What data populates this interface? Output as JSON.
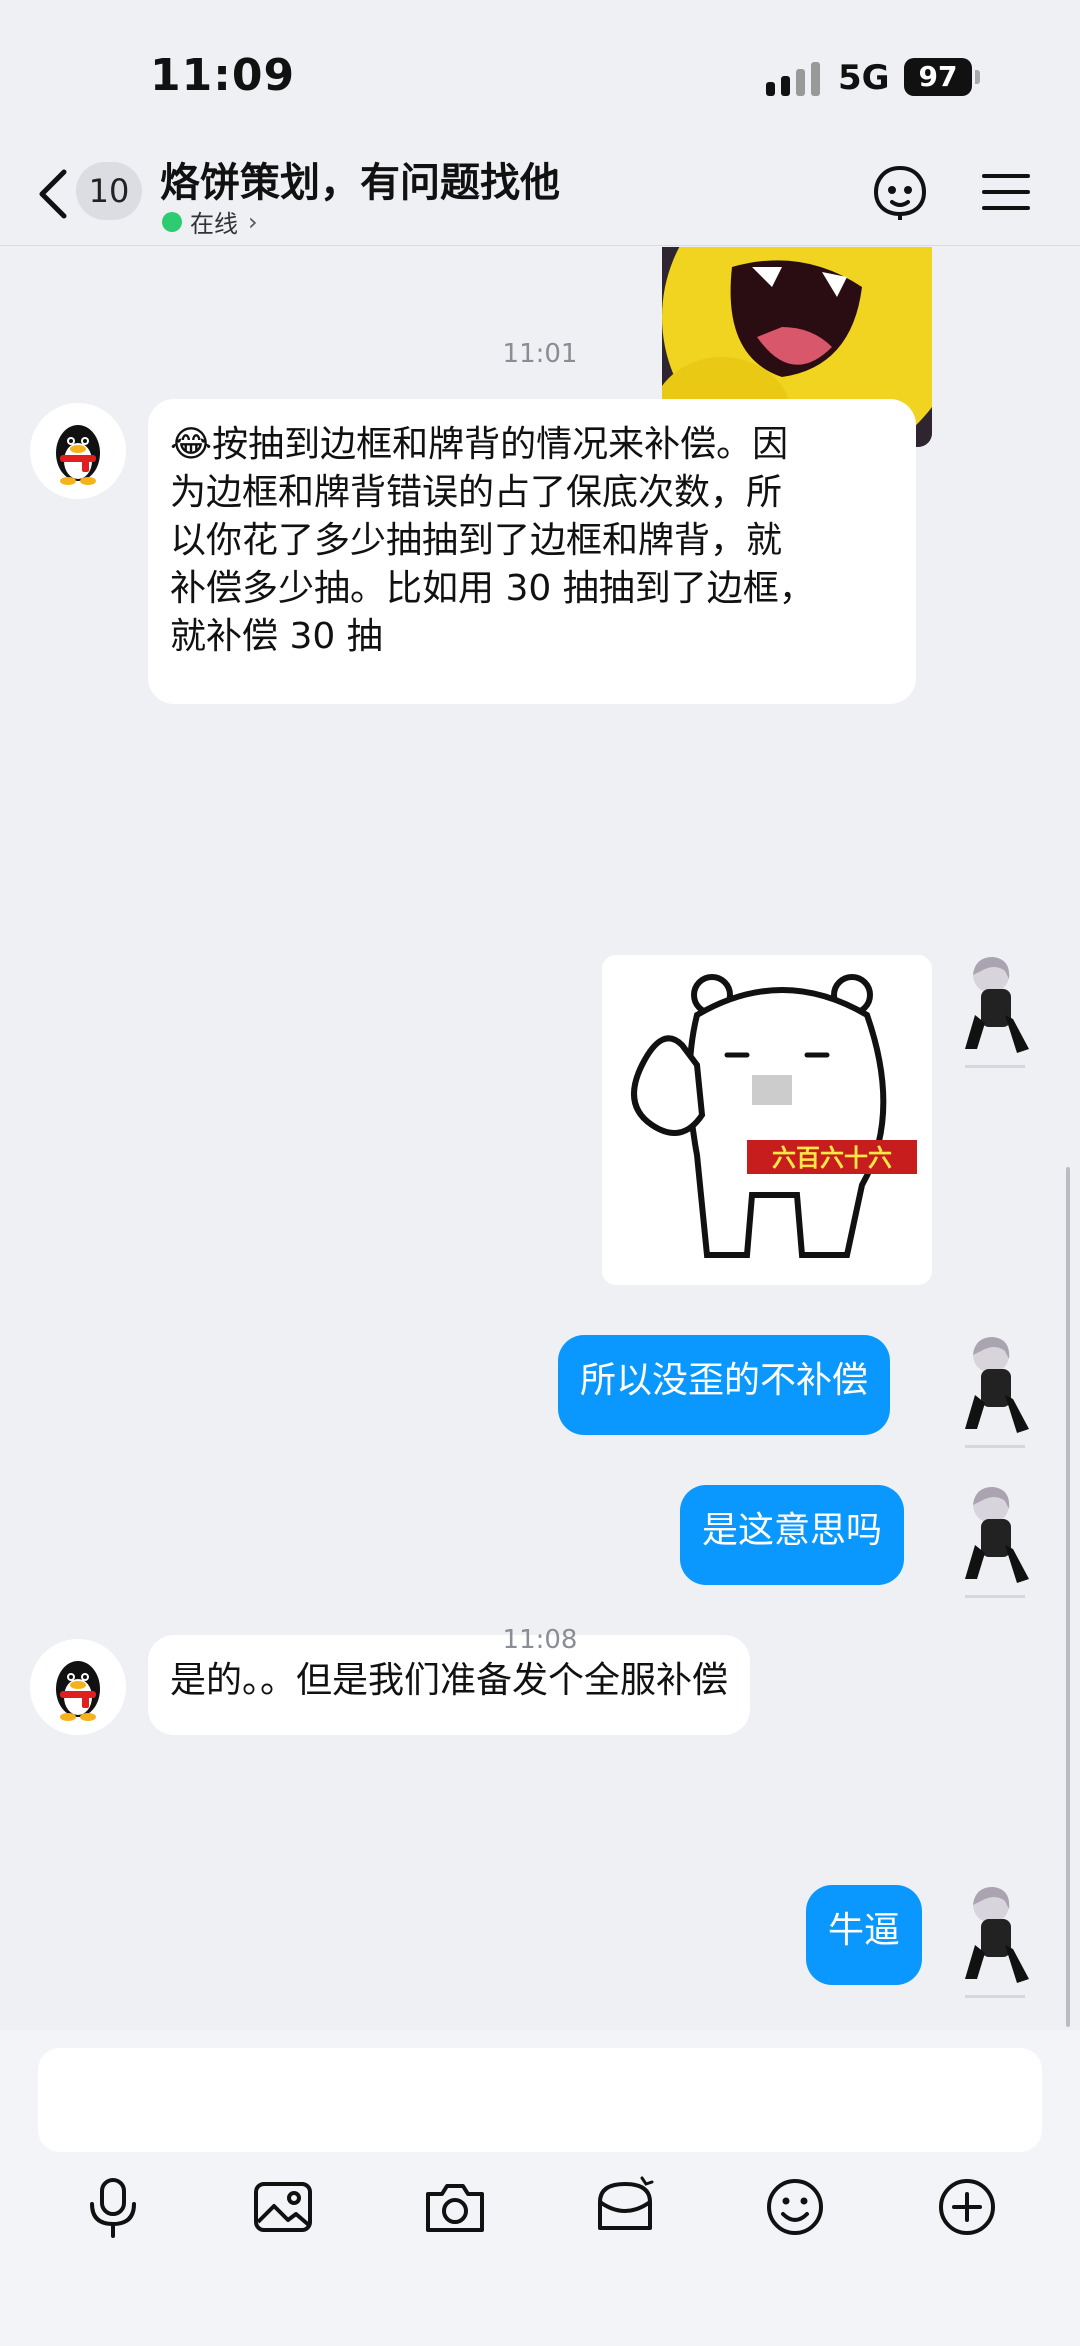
{
  "status_bar": {
    "time": "11:09",
    "network": "5G",
    "battery": "97"
  },
  "header": {
    "unread_count": "10",
    "title": "烙饼策划，有问题找他",
    "presence": "在线"
  },
  "messages": [
    {
      "type": "timestamp",
      "text": "11:01"
    },
    {
      "type": "text",
      "from": "other",
      "lines": [
        "😂按抽到边框和牌背的情况来补偿。因",
        "为边框和牌背错误的占了保底次数，所",
        "以你花了多少抽抽到了边框和牌背，就",
        "补偿多少抽。比如用 30 抽抽到了边框，",
        "就补偿 30 抽"
      ]
    },
    {
      "type": "sticker",
      "from": "me",
      "caption": "六百六十六"
    },
    {
      "type": "text",
      "from": "me",
      "text": "所以没歪的不补偿"
    },
    {
      "type": "text",
      "from": "me",
      "text": "是这意思吗"
    },
    {
      "type": "text",
      "from": "other",
      "text": "是的。。但是我们准备发个全服补偿"
    },
    {
      "type": "timestamp",
      "text": "11:08"
    },
    {
      "type": "text",
      "from": "me",
      "text": "牛逼"
    }
  ],
  "colors": {
    "outgoing_bubble": "#0a98ff",
    "incoming_bubble": "#ffffff",
    "background": "#eef0f4",
    "online": "#2ecc71"
  },
  "toolbar": {
    "icons": [
      "microphone-icon",
      "image-icon",
      "camera-icon",
      "red-packet-icon",
      "emoji-icon",
      "plus-icon"
    ]
  }
}
